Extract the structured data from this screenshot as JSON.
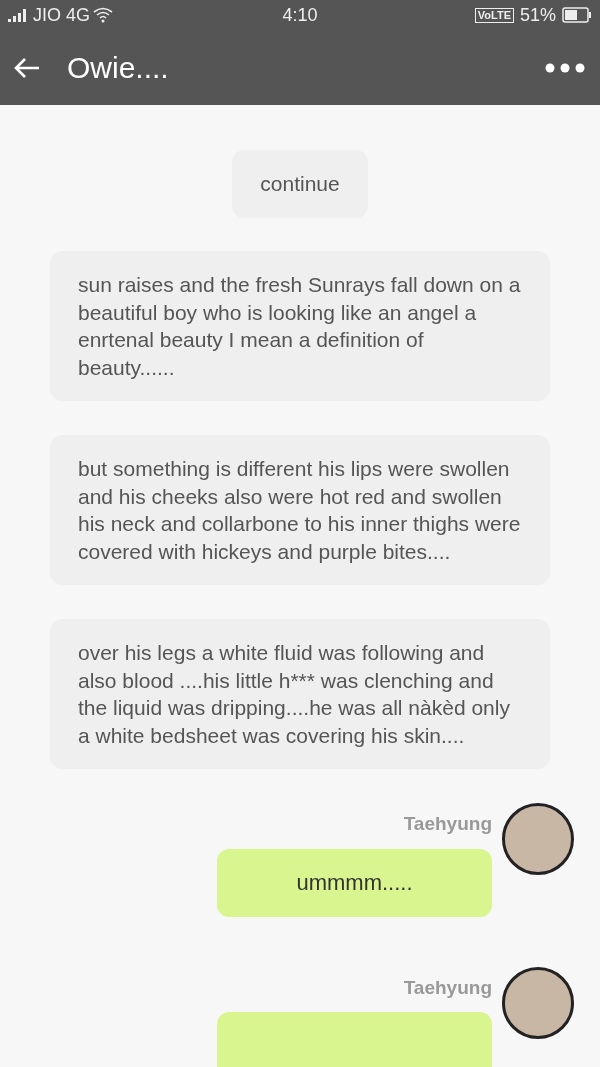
{
  "status_bar": {
    "carrier": "JIO 4G",
    "time": "4:10",
    "volte": "VoLTE",
    "battery": "51%"
  },
  "header": {
    "title": "Owie...."
  },
  "messages": [
    {
      "kind": "system",
      "text": "continue"
    },
    {
      "kind": "narration",
      "text": "sun raises and the fresh Sunrays fall down on a beautiful boy who is looking like an angel a enrtenal beauty I mean a definition of beauty......"
    },
    {
      "kind": "narration",
      "text": "but something is different his lips were swollen and his cheeks also were hot red and swollen his neck and collarbone to his inner thighs were covered with hickeys and purple bites...."
    },
    {
      "kind": "narration",
      "text": "over his legs a white fluid was following and also blood ....his little h*** was clenching and the liquid was dripping....he was all nàkèd only a white bedsheet was covering his skin...."
    },
    {
      "kind": "message",
      "sender": "Taehyung",
      "text": "ummmm....."
    },
    {
      "kind": "message",
      "sender": "Taehyung"
    }
  ]
}
